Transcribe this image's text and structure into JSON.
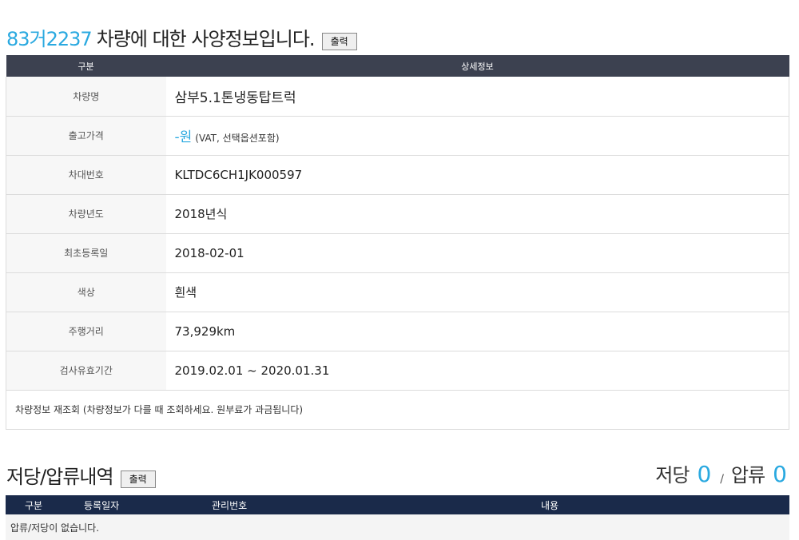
{
  "header": {
    "plate": "83거2237",
    "title_rest": "차량에 대한 사양정보입니다.",
    "print_label": "출력"
  },
  "spec_table": {
    "col_category": "구분",
    "col_detail": "상세정보",
    "rows": [
      {
        "label": "차량명",
        "value": "삼부5.1톤냉동탑트럭"
      },
      {
        "label": "출고가격",
        "value": "-원",
        "note": "(VAT, 선택옵션포함)"
      },
      {
        "label": "차대번호",
        "value": "KLTDC6CH1JK000597"
      },
      {
        "label": "차량년도",
        "value": "2018년식"
      },
      {
        "label": "최초등록일",
        "value": "2018-02-01"
      },
      {
        "label": "색상",
        "value": "흰색"
      },
      {
        "label": "주행거리",
        "value": "73,929km"
      },
      {
        "label": "검사유효기간",
        "value": "2019.02.01 ~ 2020.01.31"
      }
    ],
    "recheck_text": "차량정보 재조회 (차량정보가 다를 때 조회하세요. 원부료가 과금됩니다)"
  },
  "lien_section": {
    "title": "저당/압류내역",
    "print_label": "출력",
    "mortgage_label": "저당",
    "mortgage_count": "0",
    "separator": "/",
    "seizure_label": "압류",
    "seizure_count": "0",
    "columns": [
      "구분",
      "등록일자",
      "관리번호",
      "내용"
    ],
    "empty_message": "압류/저당이 없습니다."
  }
}
